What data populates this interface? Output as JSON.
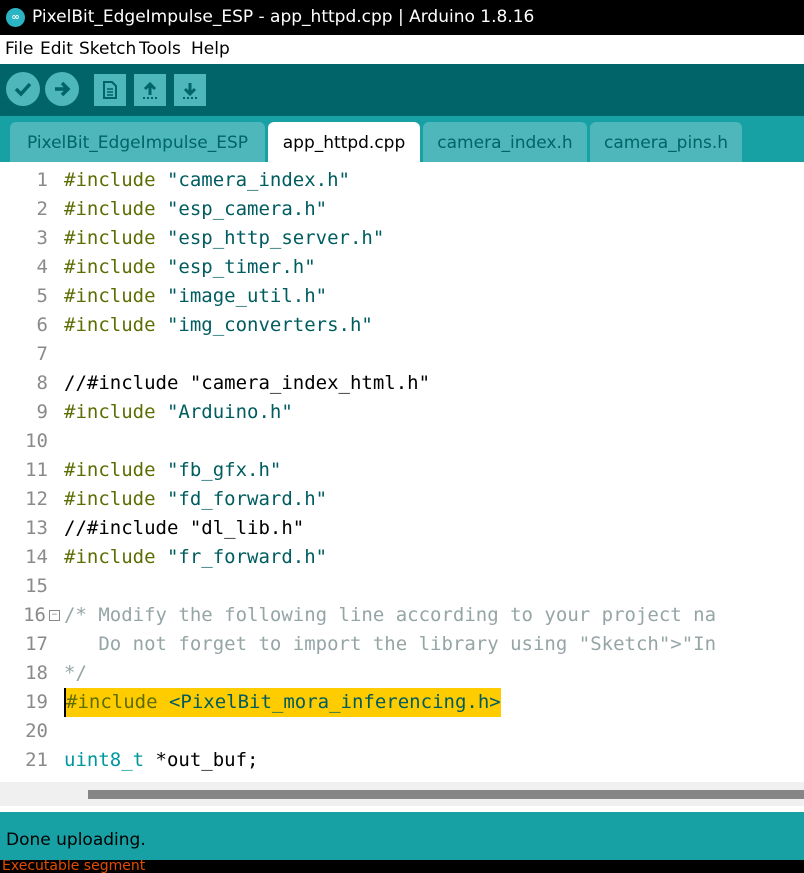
{
  "window": {
    "title": "PixelBit_EdgeImpulse_ESP - app_httpd.cpp | Arduino 1.8.16",
    "icon": "arduino-logo-icon"
  },
  "menu": [
    "File",
    "Edit",
    "Sketch",
    "Tools",
    "Help"
  ],
  "toolbar": {
    "buttons": [
      {
        "name": "verify",
        "icon": "checkmark-icon"
      },
      {
        "name": "upload",
        "icon": "arrow-right-icon"
      },
      {
        "name": "new",
        "icon": "new-file-icon"
      },
      {
        "name": "open",
        "icon": "arrow-up-icon"
      },
      {
        "name": "save",
        "icon": "arrow-down-icon"
      }
    ],
    "colors": {
      "bar": "#006468",
      "button": "#4db7bb"
    }
  },
  "tabs": [
    {
      "label": "PixelBit_EdgeImpulse_ESP",
      "active": false
    },
    {
      "label": "app_httpd.cpp",
      "active": true
    },
    {
      "label": "camera_index.h",
      "active": false
    },
    {
      "label": "camera_pins.h",
      "active": false
    }
  ],
  "editor": {
    "lines": [
      {
        "n": "1",
        "kw": "#include",
        "str": "\"camera_index.h\""
      },
      {
        "n": "2",
        "kw": "#include",
        "str": "\"esp_camera.h\""
      },
      {
        "n": "3",
        "kw": "#include",
        "str": "\"esp_http_server.h\""
      },
      {
        "n": "4",
        "kw": "#include",
        "str": "\"esp_timer.h\""
      },
      {
        "n": "5",
        "kw": "#include",
        "str": "\"image_util.h\""
      },
      {
        "n": "6",
        "kw": "#include",
        "str": "\"img_converters.h\""
      },
      {
        "n": "7"
      },
      {
        "n": "8",
        "plain": "//#include \"camera_index_html.h\""
      },
      {
        "n": "9",
        "kw": "#include",
        "str": "\"Arduino.h\""
      },
      {
        "n": "10"
      },
      {
        "n": "11",
        "kw": "#include",
        "str": "\"fb_gfx.h\""
      },
      {
        "n": "12",
        "kw": "#include",
        "str": "\"fd_forward.h\""
      },
      {
        "n": "13",
        "plain": "//#include \"dl_lib.h\""
      },
      {
        "n": "14",
        "kw": "#include",
        "str": "\"fr_forward.h\""
      },
      {
        "n": "15"
      },
      {
        "n": "16",
        "cmt": "/* Modify the following line according to your project na"
      },
      {
        "n": "17",
        "cmt": "   Do not forget to import the library using \"Sketch\">\"In"
      },
      {
        "n": "18",
        "cmt": "*/"
      },
      {
        "n": "19",
        "kw": "#include",
        "str": "<PixelBit_mora_inferencing.h>"
      },
      {
        "n": "20"
      },
      {
        "n": "21",
        "typ": "uint8_t",
        "plain": "*out_buf;"
      }
    ],
    "highlighted_line": "19",
    "colors": {
      "keyword": "#5e6d03",
      "string": "#005c5f",
      "comment": "#95a5a6",
      "type": "#00979c",
      "highlight": "#ffcc00"
    }
  },
  "status": {
    "message": "Done uploading."
  },
  "console": {
    "text": "Executable segment"
  }
}
